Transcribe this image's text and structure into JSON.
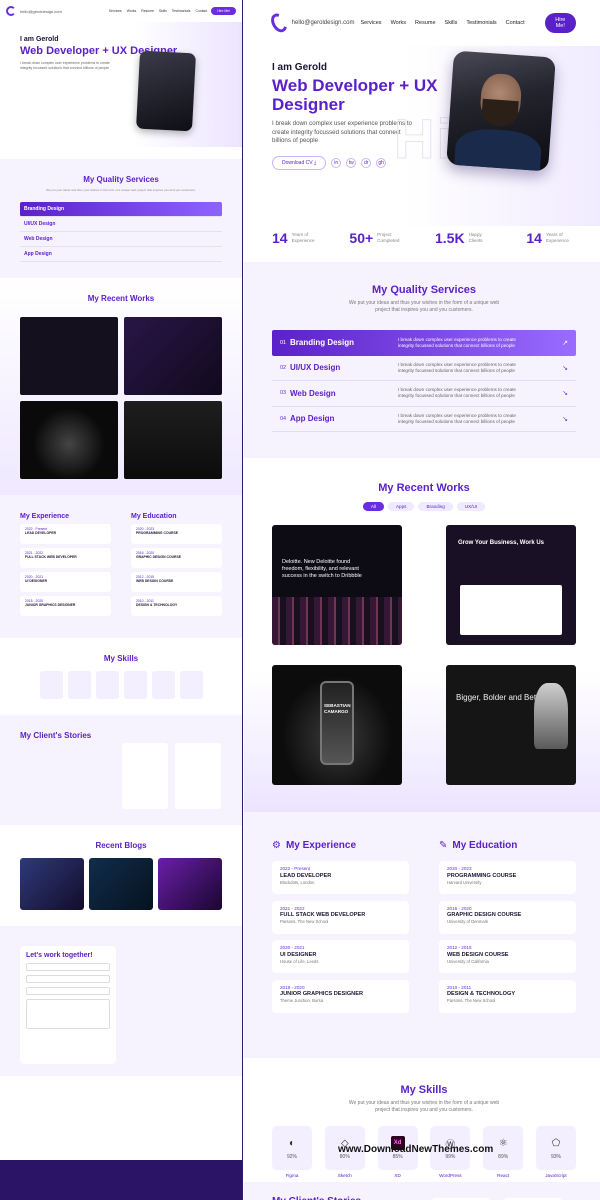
{
  "nav": {
    "email": "hello@geroldesign.com",
    "links": [
      "Services",
      "Works",
      "Resume",
      "Skills",
      "Testimonials",
      "Contact"
    ],
    "hire_label": "Hire Me!"
  },
  "hero": {
    "greeting": "I am Gerold",
    "role": "Web Developer + UX Designer",
    "intro": "I break down complex user experience problems to create integrity focussed solutions that connect billions of people",
    "cv_label": "Download CV",
    "socials": [
      "in",
      "tw",
      "dr",
      "gh"
    ]
  },
  "stats": [
    {
      "value": "14",
      "label": "Years of Experience"
    },
    {
      "value": "50+",
      "label": "Project Completed"
    },
    {
      "value": "1.5K",
      "label": "Happy Clients"
    },
    {
      "value": "14",
      "label": "Years of Experience"
    }
  ],
  "services": {
    "title": "My Quality Services",
    "subtitle": "We put your ideas and thus your wishes in the form of a unique web project that inspires you and you customers.",
    "items": [
      {
        "num": "01",
        "name": "Branding Design",
        "text": "I break down complex user experience problems to create integrity focussed solutions that connect billions of people"
      },
      {
        "num": "02",
        "name": "UI/UX Design",
        "text": "I break down complex user experience problems to create integrity focussed solutions that connect billions of people"
      },
      {
        "num": "03",
        "name": "Web Design",
        "text": "I break down complex user experience problems to create integrity focussed solutions that connect billions of people"
      },
      {
        "num": "04",
        "name": "App Design",
        "text": "I break down complex user experience problems to create integrity focussed solutions that connect billions of people"
      }
    ]
  },
  "works": {
    "title": "My Recent Works",
    "filters": [
      "All",
      "Apps",
      "Branding",
      "UX/UI"
    ],
    "cards": [
      {
        "text": "Deloitte. New Deloitte found freedom, flexibility, and relevant success in the switch to Dribbble"
      },
      {
        "text": "Grow Your Business, Work Us"
      },
      {
        "text": "SEBASTIAN CAMARGO"
      },
      {
        "text": "Bigger, Bolder and Better"
      }
    ]
  },
  "experience": {
    "title": "My Experience",
    "items": [
      {
        "date": "2022 - Present",
        "title": "LEAD DEVELOPER",
        "place": "Blockdots, London"
      },
      {
        "date": "2021 - 2022",
        "title": "FULL STACK WEB DEVELOPER",
        "place": "Parsons, The New School"
      },
      {
        "date": "2020 - 2021",
        "title": "UI DESIGNER",
        "place": "House of Life, Leeds"
      },
      {
        "date": "2018 - 2020",
        "title": "JUNIOR GRAPHICS DESIGNER",
        "place": "Theme Junction, Bursa"
      }
    ]
  },
  "education": {
    "title": "My Education",
    "items": [
      {
        "date": "2020 - 2023",
        "title": "PROGRAMMING COURSE",
        "place": "Harvard University"
      },
      {
        "date": "2016 - 2020",
        "title": "GRAPHIC DESIGN COURSE",
        "place": "University of Denmark"
      },
      {
        "date": "2012 - 2015",
        "title": "WEB DESIGN COURSE",
        "place": "University of California"
      },
      {
        "date": "2010 - 2011",
        "title": "DESIGN & TECHNOLOGY",
        "place": "Parsons, The New School"
      }
    ]
  },
  "skills": {
    "title": "My Skills",
    "subtitle": "We put your ideas and thus your wishes in the form of a unique web project that inspires you and you customers.",
    "items": [
      {
        "name": "Figma",
        "pct": "92%",
        "icon": "figma-icon"
      },
      {
        "name": "Sketch",
        "pct": "80%",
        "icon": "sketch-icon"
      },
      {
        "name": "XD",
        "pct": "85%",
        "icon": "xd-icon"
      },
      {
        "name": "WordPress",
        "pct": "99%",
        "icon": "wordpress-icon"
      },
      {
        "name": "React",
        "pct": "89%",
        "icon": "react-icon"
      },
      {
        "name": "JavaScript",
        "pct": "93%",
        "icon": "html5-icon"
      }
    ]
  },
  "stories": {
    "title": "My Client's Stories"
  },
  "thumb": {
    "blogs_title": "Recent Blogs",
    "contact_title": "Let's work together!"
  },
  "credit": "www.DownloadNewThemes.com",
  "colors": {
    "accent": "#5b21c8",
    "accent_light": "#f6f3ff"
  }
}
